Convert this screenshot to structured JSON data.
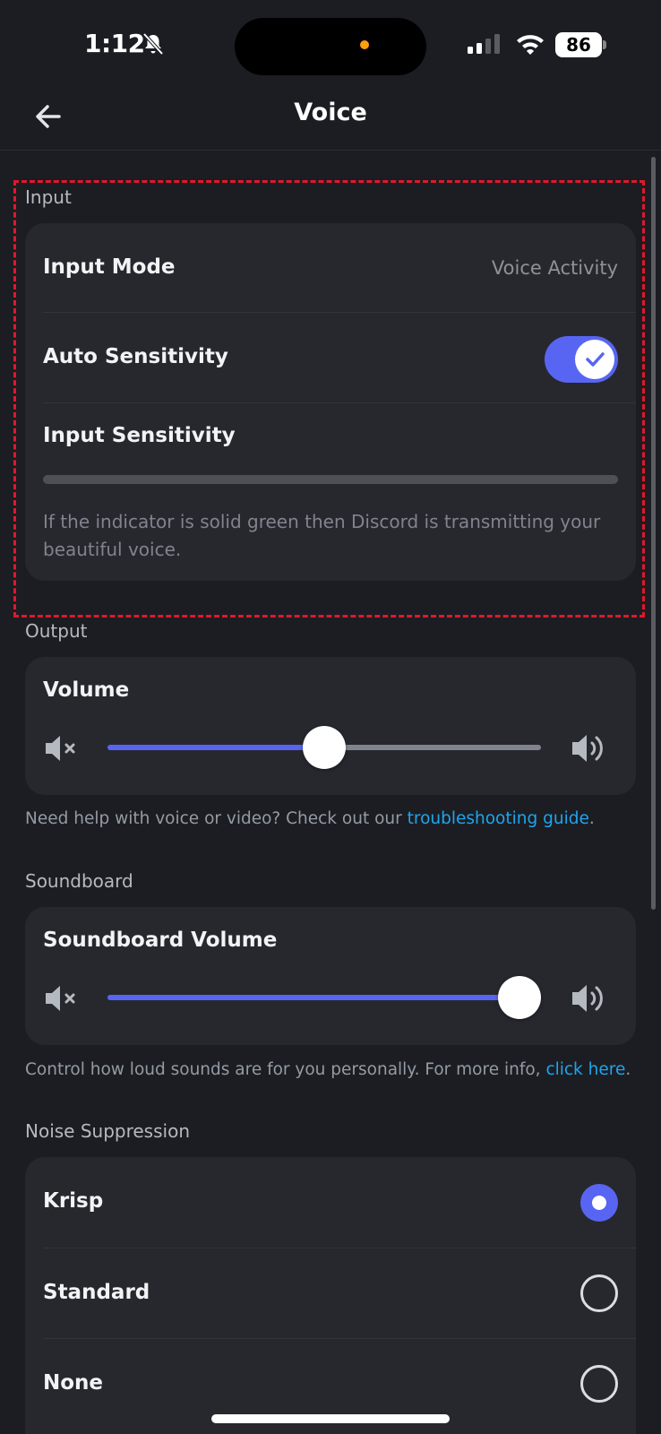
{
  "status": {
    "time": "1:12",
    "battery": "86"
  },
  "header": {
    "title": "Voice"
  },
  "input": {
    "section_label": "Input",
    "mode_label": "Input Mode",
    "mode_value": "Voice Activity",
    "auto_sensitivity_label": "Auto Sensitivity",
    "auto_sensitivity_on": true,
    "input_sensitivity_label": "Input Sensitivity",
    "help_text": "If the indicator is solid green then Discord is transmitting your beautiful voice."
  },
  "output": {
    "section_label": "Output",
    "volume_label": "Volume",
    "volume_fraction": 0.5,
    "note_prefix": "Need help with voice or video? Check out our ",
    "note_link": "troubleshooting guide",
    "note_suffix": "."
  },
  "soundboard": {
    "section_label": "Soundboard",
    "volume_label": "Soundboard Volume",
    "volume_fraction": 1.0,
    "note_prefix": "Control how loud sounds are for you personally. For more info, ",
    "note_link": "click here",
    "note_suffix": "."
  },
  "noise_suppression": {
    "section_label": "Noise Suppression",
    "options": [
      {
        "label": "Krisp",
        "selected": true
      },
      {
        "label": "Standard",
        "selected": false
      },
      {
        "label": "None",
        "selected": false
      }
    ]
  },
  "colors": {
    "accent": "#5865f2",
    "link": "#1ea5ee",
    "highlight": "#e0182c"
  }
}
